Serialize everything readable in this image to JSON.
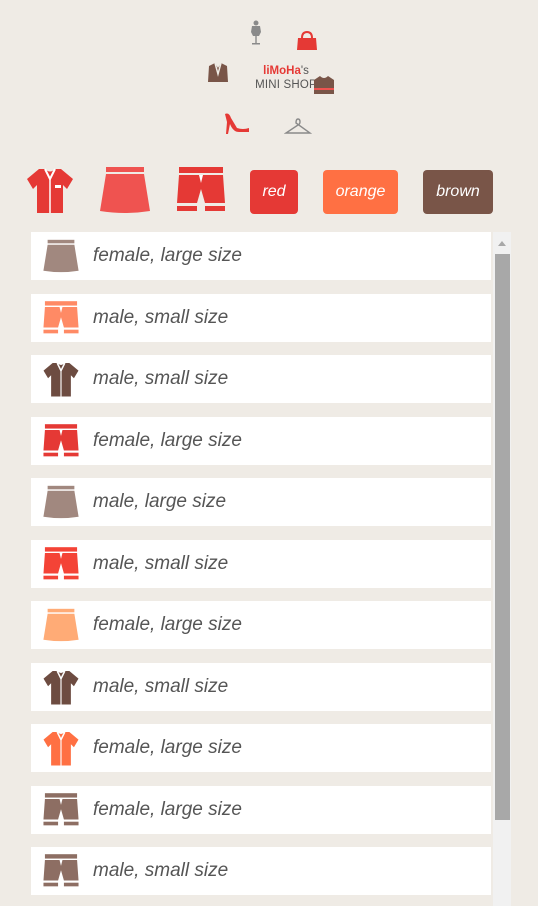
{
  "brand": {
    "name": "liMoHa",
    "suffix": "'s",
    "subtitle": "MINI SHOP"
  },
  "logo_icons": [
    "mannequin-icon",
    "handbag-icon",
    "jacket-icon",
    "sweater-icon",
    "high-heel-icon",
    "hanger-icon"
  ],
  "filters": {
    "types": [
      {
        "name": "shirt",
        "color": "#e53935"
      },
      {
        "name": "skirt",
        "color": "#ef5350"
      },
      {
        "name": "shorts",
        "color": "#e53935"
      }
    ],
    "colors": [
      {
        "label": "red",
        "color": "#e53935"
      },
      {
        "label": "orange",
        "color": "#ff7043"
      },
      {
        "label": "brown",
        "color": "#795548"
      }
    ]
  },
  "items": [
    {
      "type": "skirt",
      "color": "#a1887f",
      "label": "female, large size"
    },
    {
      "type": "shorts",
      "color": "#ff8a65",
      "label": "male, small size"
    },
    {
      "type": "shirt",
      "color": "#6d4c41",
      "label": "male, small size"
    },
    {
      "type": "shorts",
      "color": "#e53935",
      "label": "female, large size"
    },
    {
      "type": "skirt",
      "color": "#a1887f",
      "label": "male, large size"
    },
    {
      "type": "shorts",
      "color": "#f44336",
      "label": "male, small size"
    },
    {
      "type": "skirt",
      "color": "#ffab76",
      "label": "female, large size"
    },
    {
      "type": "shirt",
      "color": "#6d4c41",
      "label": "male, small size"
    },
    {
      "type": "shirt",
      "color": "#ff7043",
      "label": "female, large size"
    },
    {
      "type": "shorts",
      "color": "#8d6e63",
      "label": "female, large size"
    },
    {
      "type": "shorts",
      "color": "#8d6e63",
      "label": "male, small size"
    }
  ]
}
